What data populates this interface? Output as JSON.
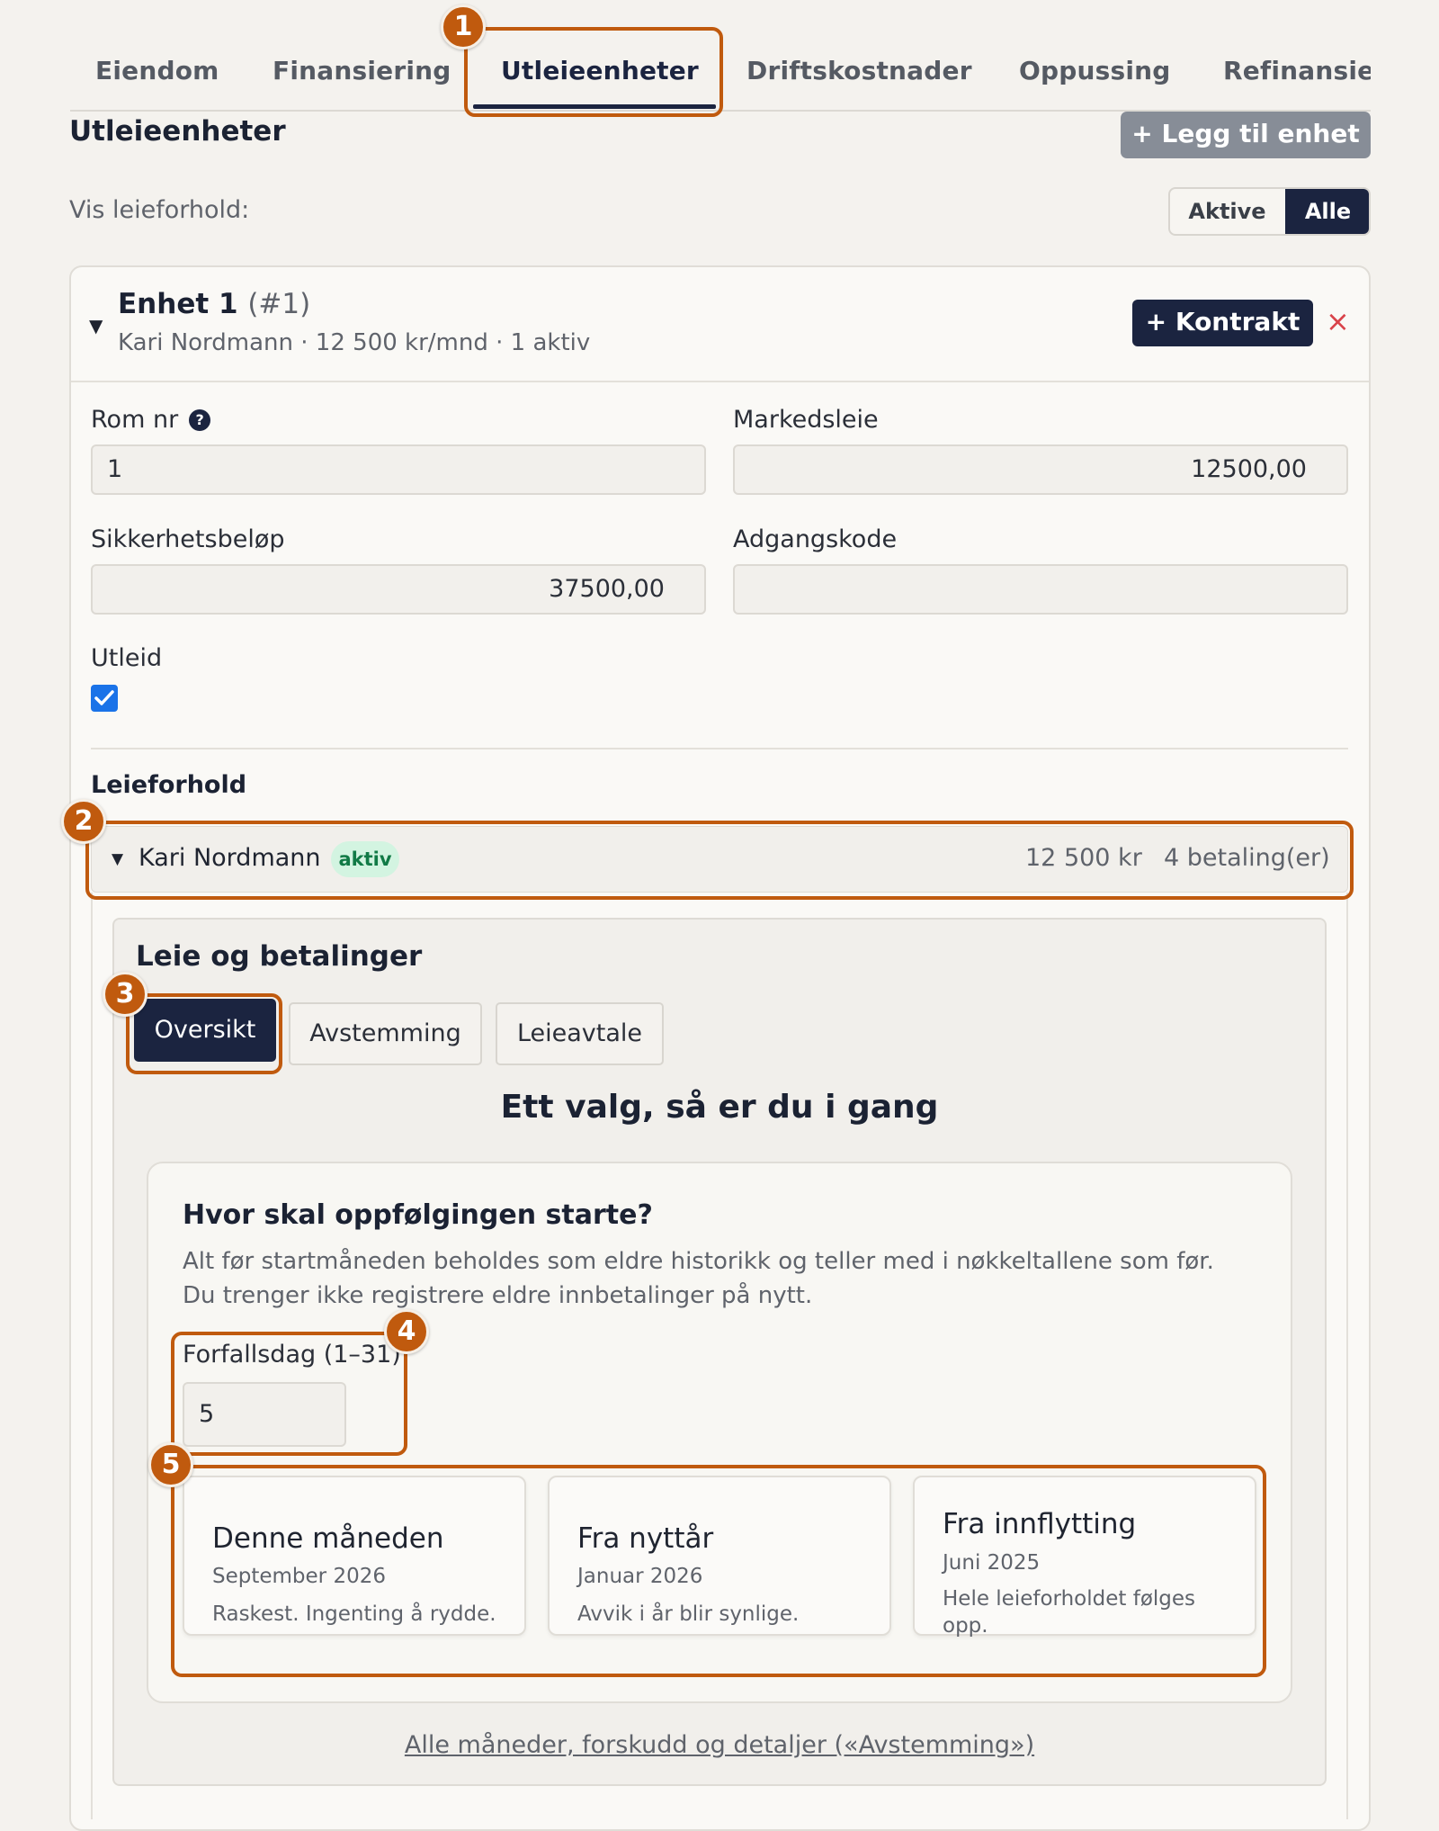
{
  "tabs": [
    {
      "label": "Eiendom"
    },
    {
      "label": "Finansiering"
    },
    {
      "label": "Utleieenheter"
    },
    {
      "label": "Driftskostnader"
    },
    {
      "label": "Oppussing"
    },
    {
      "label": "Refinansiering"
    }
  ],
  "active_tab": "Utleieenheter",
  "section": {
    "title": "Utleieenheter",
    "add_button": "+ Legg til enhet"
  },
  "filter": {
    "label": "Vis leieforhold:",
    "options": [
      "Aktive",
      "Alle"
    ],
    "selected": "Alle"
  },
  "unit": {
    "caret": "▼",
    "name": "Enhet 1",
    "number": "(#1)",
    "summary": "Kari Nordmann · 12 500 kr/mnd · 1 aktiv",
    "contract_button": "+ Kontrakt",
    "remove_icon": "×",
    "fields": {
      "room_label": "Rom nr",
      "room_help": "?",
      "room_value": "1",
      "market_label": "Markedsleie",
      "market_value": "12500,00",
      "deposit_label": "Sikkerhetsbeløp",
      "deposit_value": "37500,00",
      "access_label": "Adgangskode",
      "access_value": "",
      "rented_label": "Utleid",
      "rented_checked": true
    }
  },
  "leases": {
    "title": "Leieforhold",
    "item": {
      "caret": "▼",
      "tenant": "Kari Nordmann",
      "status": "aktiv",
      "amount": "12 500 kr",
      "payments": "4 betaling(er)"
    }
  },
  "payments": {
    "title": "Leie og betalinger",
    "tabs": [
      "Oversikt",
      "Avstemming",
      "Leieavtale"
    ],
    "active_tab": "Oversikt",
    "headline": "Ett valg, så er du i gang",
    "question": "Hvor skal oppfølgingen starte?",
    "description_1": "Alt før startmåneden beholdes som eldre historikk og teller med i nøkkeltallene som før.",
    "description_2": "Du trenger ikke registrere eldre innbetalinger på nytt.",
    "due_label": "Forfallsdag (1–31)",
    "due_value": "5",
    "options": [
      {
        "title": "Denne måneden",
        "date": "September 2026",
        "note": "Raskest. Ingenting å rydde."
      },
      {
        "title": "Fra nyttår",
        "date": "Januar 2026",
        "note": "Avvik i år blir synlige."
      },
      {
        "title": "Fra innflytting",
        "date": "Juni 2025",
        "note": "Hele leieforholdet følges opp."
      }
    ],
    "link": "Alle måneder, forskudd og detaljer («Avstemming»)"
  },
  "callouts": [
    "1",
    "2",
    "3",
    "4",
    "5"
  ],
  "colors": {
    "primary": "#1b2440",
    "callout": "#c05a0e",
    "danger": "#d9434a",
    "badge_bg": "#d3f4e1",
    "badge_text": "#117a46",
    "checkbox": "#1a73e8"
  }
}
